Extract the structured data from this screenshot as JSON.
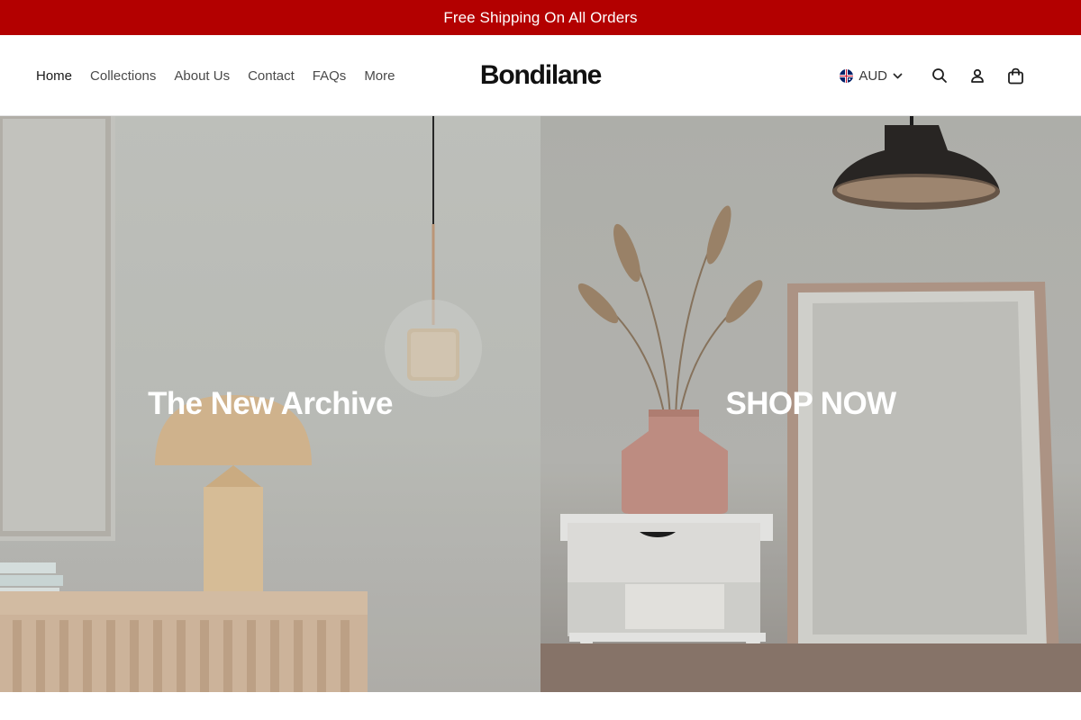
{
  "announcement": {
    "text": "Free Shipping On All Orders",
    "background": "#b30000"
  },
  "nav": {
    "items": [
      {
        "label": "Home"
      },
      {
        "label": "Collections"
      },
      {
        "label": "About Us"
      },
      {
        "label": "Contact"
      },
      {
        "label": "FAQs"
      },
      {
        "label": "More"
      }
    ]
  },
  "brand": {
    "logo_text": "Bondilane"
  },
  "utilities": {
    "currency": "AUD",
    "icons": [
      "australia-flag-icon",
      "chevron-down-icon",
      "search-icon",
      "account-icon",
      "cart-bag-icon"
    ]
  },
  "hero": {
    "left": {
      "heading": "The New Archive"
    },
    "right": {
      "heading": "SHOP NOW"
    }
  }
}
